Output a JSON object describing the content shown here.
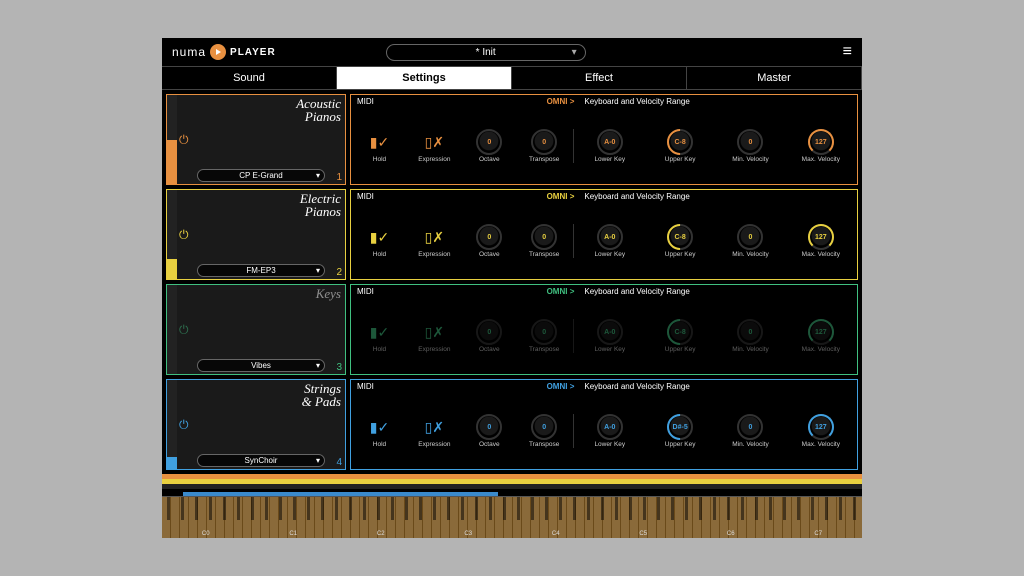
{
  "logo": {
    "brand": "numa",
    "product": "PLAYER"
  },
  "preset_name": "* Init",
  "tabs": [
    "Sound",
    "Settings",
    "Effect",
    "Master"
  ],
  "active_tab": 1,
  "section_labels": {
    "midi": "MIDI",
    "omni": "OMNI >",
    "range": "Keyboard and Velocity Range"
  },
  "ctrl_labels": {
    "hold": "Hold",
    "expression": "Expression",
    "octave": "Octave",
    "transpose": "Transpose",
    "lower": "Lower Key",
    "upper": "Upper Key",
    "minv": "Min. Velocity",
    "maxv": "Max. Velocity"
  },
  "slots": [
    {
      "category": "Acoustic Pianos",
      "preset": "CP E-Grand",
      "num": "1",
      "color": "orange",
      "active": true,
      "meter": 50,
      "octave": "0",
      "transpose": "0",
      "lower": "A-0",
      "upper": "C-8",
      "minv": "0",
      "maxv": "127"
    },
    {
      "category": "Electric Pianos",
      "preset": "FM-EP3",
      "num": "2",
      "color": "yellow",
      "active": true,
      "meter": 22,
      "octave": "0",
      "transpose": "0",
      "lower": "A-0",
      "upper": "C-8",
      "minv": "0",
      "maxv": "127"
    },
    {
      "category": "Keys",
      "preset": "Vibes",
      "num": "3",
      "color": "green",
      "active": false,
      "meter": 0,
      "octave": "0",
      "transpose": "0",
      "lower": "A-0",
      "upper": "C-8",
      "minv": "0",
      "maxv": "127"
    },
    {
      "category": "Strings & Pads",
      "preset": "SynChoir",
      "num": "4",
      "color": "blue",
      "active": true,
      "meter": 14,
      "octave": "0",
      "transpose": "0",
      "lower": "A-0",
      "upper": "D#-5",
      "minv": "0",
      "maxv": "127"
    }
  ],
  "octaves": [
    "C0",
    "C1",
    "C2",
    "C3",
    "C4",
    "C5",
    "C6",
    "C7"
  ]
}
